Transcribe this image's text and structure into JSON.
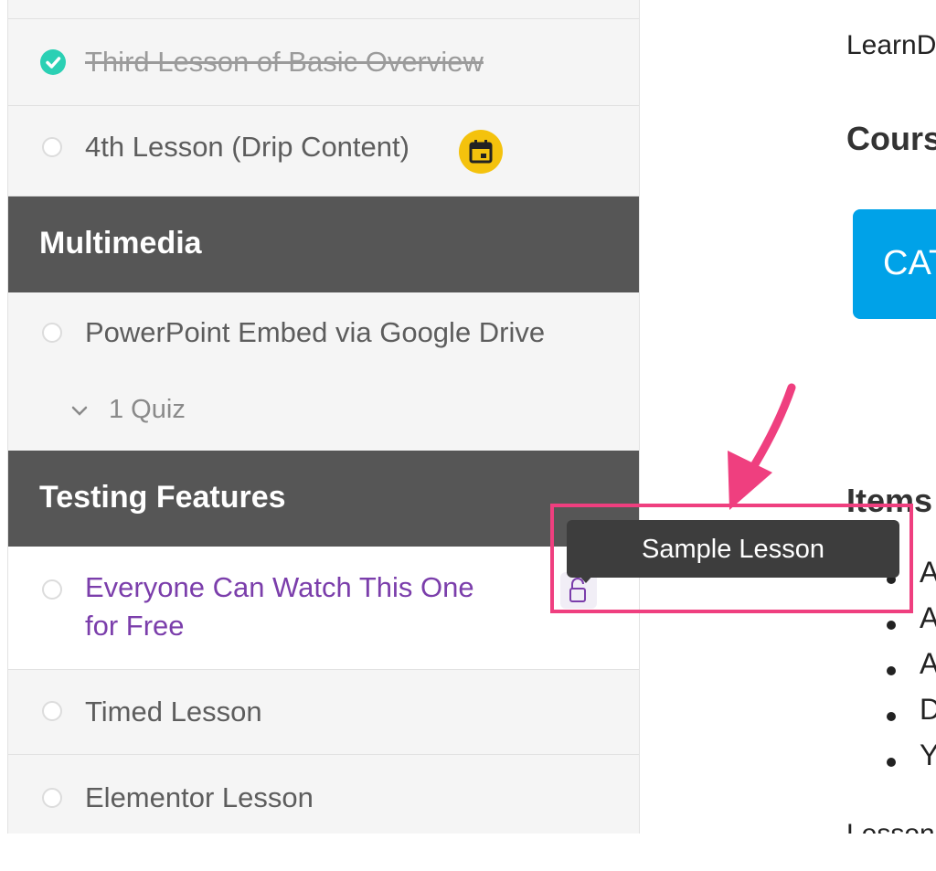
{
  "sidebar": {
    "lessons_top": [
      {
        "label": "Third Lesson of Basic Overview",
        "completed": true
      },
      {
        "label": "4th Lesson (Drip Content)",
        "completed": false,
        "badge_icon": "calendar-icon"
      }
    ],
    "sections": [
      {
        "title": "Multimedia"
      },
      {
        "title": "Testing Features"
      }
    ],
    "multimedia_lessons": [
      {
        "label": "PowerPoint Embed via Google Drive",
        "completed": false
      }
    ],
    "quiz_toggle": {
      "label": "1 Quiz"
    },
    "testing_lessons": [
      {
        "label_line1": "Everyone Can Watch This One",
        "label_line2": "for Free",
        "completed": false,
        "active": true
      },
      {
        "label": "Timed Lesson",
        "completed": false
      },
      {
        "label": "Elementor Lesson",
        "completed": false
      }
    ]
  },
  "main": {
    "intro_text": "LearnD",
    "course_heading": "Cours",
    "cat_button_label": "CAT",
    "items_heading": "Items",
    "bullets": [
      "A",
      "A",
      "A",
      "D",
      "Y"
    ],
    "bottom_text": "Lesson"
  },
  "tooltip": {
    "text": "Sample Lesson"
  },
  "colors": {
    "section_header": "#565656",
    "completed_check": "#2bd0b4",
    "drip_badge": "#f4c20d",
    "active_link": "#7b3eab",
    "annotation": "#ef3f7f",
    "cat_button": "#00a2e8"
  }
}
